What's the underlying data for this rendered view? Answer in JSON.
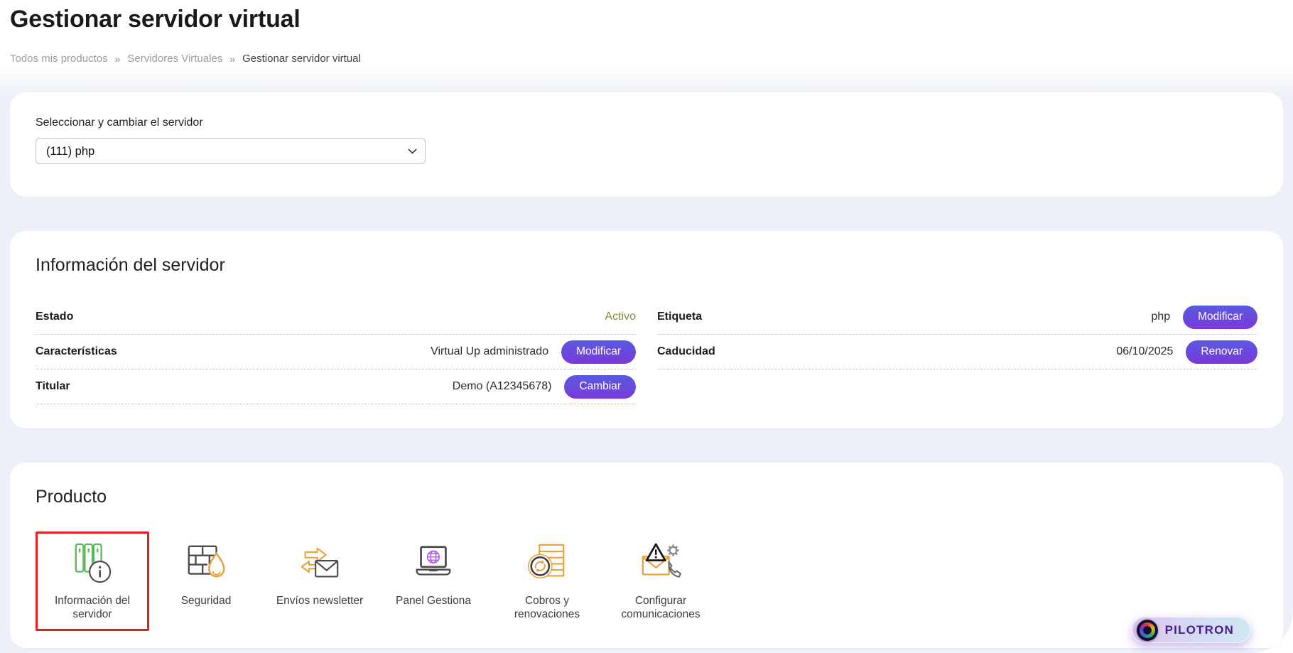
{
  "header": {
    "title": "Gestionar servidor virtual"
  },
  "breadcrumb": {
    "separator": "»",
    "items": [
      "Todos mis productos",
      "Servidores Virtuales",
      "Gestionar servidor virtual"
    ]
  },
  "selector": {
    "label": "Seleccionar y cambiar el servidor",
    "value": "(111) php"
  },
  "server_info": {
    "title": "Información del servidor",
    "left_rows": [
      {
        "label": "Estado",
        "value": "Activo"
      },
      {
        "label": "Características",
        "value": "Virtual Up administrado",
        "button": "Modificar"
      },
      {
        "label": "Titular",
        "value": "Demo (A12345678)",
        "button": "Cambiar"
      }
    ],
    "right_rows": [
      {
        "label": "Etiqueta",
        "value": "php",
        "button": "Modificar"
      },
      {
        "label": "Caducidad",
        "value": "06/10/2025",
        "button": "Renovar"
      }
    ]
  },
  "product": {
    "title": "Producto",
    "tiles": [
      {
        "label": "Información del servidor",
        "icon": "server-info-icon",
        "selected": true
      },
      {
        "label": "Seguridad",
        "icon": "firewall-icon",
        "selected": false
      },
      {
        "label": "Envíos newsletter",
        "icon": "newsletter-icon",
        "selected": false
      },
      {
        "label": "Panel Gestiona",
        "icon": "laptop-globe-icon",
        "selected": false
      },
      {
        "label": "Cobros y renovaciones",
        "icon": "billing-renewals-icon",
        "selected": false
      },
      {
        "label": "Configurar comunicaciones",
        "icon": "communications-icon",
        "selected": false
      }
    ]
  },
  "pilotron": {
    "label": "PILOTRON"
  },
  "colors": {
    "button_gradient_top": "#585ae2",
    "button_gradient_bottom": "#7b39d8",
    "status_active": "#7d8c3a",
    "selected_tile_border": "#e0211f",
    "content_background": "#edf0f8",
    "icon_green": "#5cb85c",
    "icon_orange": "#eba23b",
    "icon_purple": "#a855f7"
  }
}
